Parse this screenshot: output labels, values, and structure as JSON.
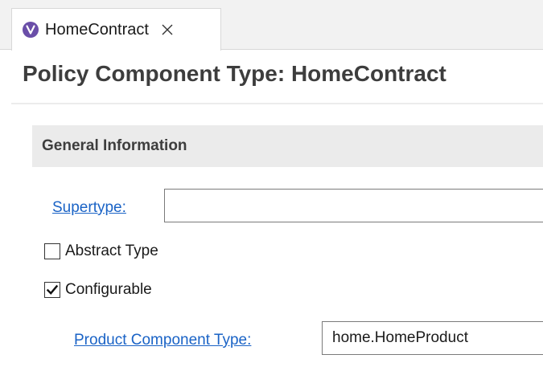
{
  "tab": {
    "label": "HomeContract",
    "icon": "policy-cmpt-type-icon",
    "close_icon": "close-icon"
  },
  "editor": {
    "title": "Policy Component Type: HomeContract"
  },
  "section": {
    "title": "General Information",
    "supertype": {
      "label": "Supertype:",
      "value": ""
    },
    "abstract_type": {
      "label": "Abstract Type",
      "checked": false
    },
    "configurable": {
      "label": "Configurable",
      "checked": true
    },
    "product_component_type": {
      "label": "Product Component Type:",
      "value": "home.HomeProduct"
    }
  },
  "colors": {
    "link": "#1a63c6",
    "tab_icon": "#6a4ea8",
    "section_header_bg": "#ebebeb",
    "title_text": "#3d3d3d"
  }
}
